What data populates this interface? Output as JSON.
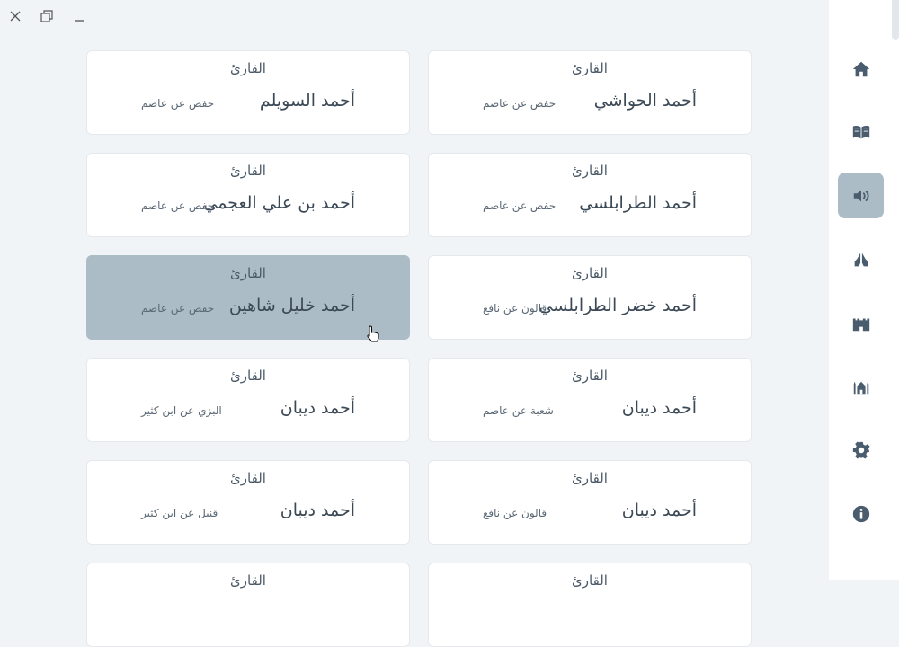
{
  "window": {
    "close_label": "✕",
    "restore_label": "❐",
    "minimize_label": "–"
  },
  "sidebar": {
    "items": [
      {
        "id": "home",
        "icon": "home-icon"
      },
      {
        "id": "quran",
        "icon": "book-open-icon"
      },
      {
        "id": "audio",
        "icon": "volume-icon",
        "active": true
      },
      {
        "id": "supplication",
        "icon": "praying-hands-icon"
      },
      {
        "id": "kaaba",
        "icon": "fort-icon"
      },
      {
        "id": "mosque",
        "icon": "mosque-icon"
      },
      {
        "id": "settings",
        "icon": "gear-icon"
      },
      {
        "id": "about",
        "icon": "info-icon"
      }
    ]
  },
  "reciters": [
    {
      "label": "القارئ",
      "name": "أحمد الحواشي",
      "riwaya": "حفص عن عاصم"
    },
    {
      "label": "القارئ",
      "name": "أحمد السويلم",
      "riwaya": "حفص عن عاصم"
    },
    {
      "label": "القارئ",
      "name": "أحمد الطرابلسي",
      "riwaya": "حفص عن عاصم"
    },
    {
      "label": "القارئ",
      "name": "أحمد بن علي العجمي",
      "riwaya": "حفص عن عاصم"
    },
    {
      "label": "القارئ",
      "name": "أحمد خضر الطرابلسي",
      "riwaya": "قالون عن نافع"
    },
    {
      "label": "القارئ",
      "name": "أحمد خليل شاهين",
      "riwaya": "حفص عن عاصم",
      "hover": true
    },
    {
      "label": "القارئ",
      "name": "أحمد ديبان",
      "riwaya": "شعبة عن عاصم"
    },
    {
      "label": "القارئ",
      "name": "أحمد ديبان",
      "riwaya": "البزي عن ابن كثير"
    },
    {
      "label": "القارئ",
      "name": "أحمد ديبان",
      "riwaya": "قالون عن نافع"
    },
    {
      "label": "القارئ",
      "name": "أحمد ديبان",
      "riwaya": "قنبل عن ابن كثير"
    },
    {
      "label": "القارئ",
      "name": "",
      "riwaya": ""
    },
    {
      "label": "القارئ",
      "name": "",
      "riwaya": ""
    }
  ],
  "colors": {
    "background": "#f1f4f7",
    "card": "#ffffff",
    "card_hover": "#abbcc6",
    "sidebar_active": "#abbcc6",
    "icon": "#4a5d6e"
  }
}
